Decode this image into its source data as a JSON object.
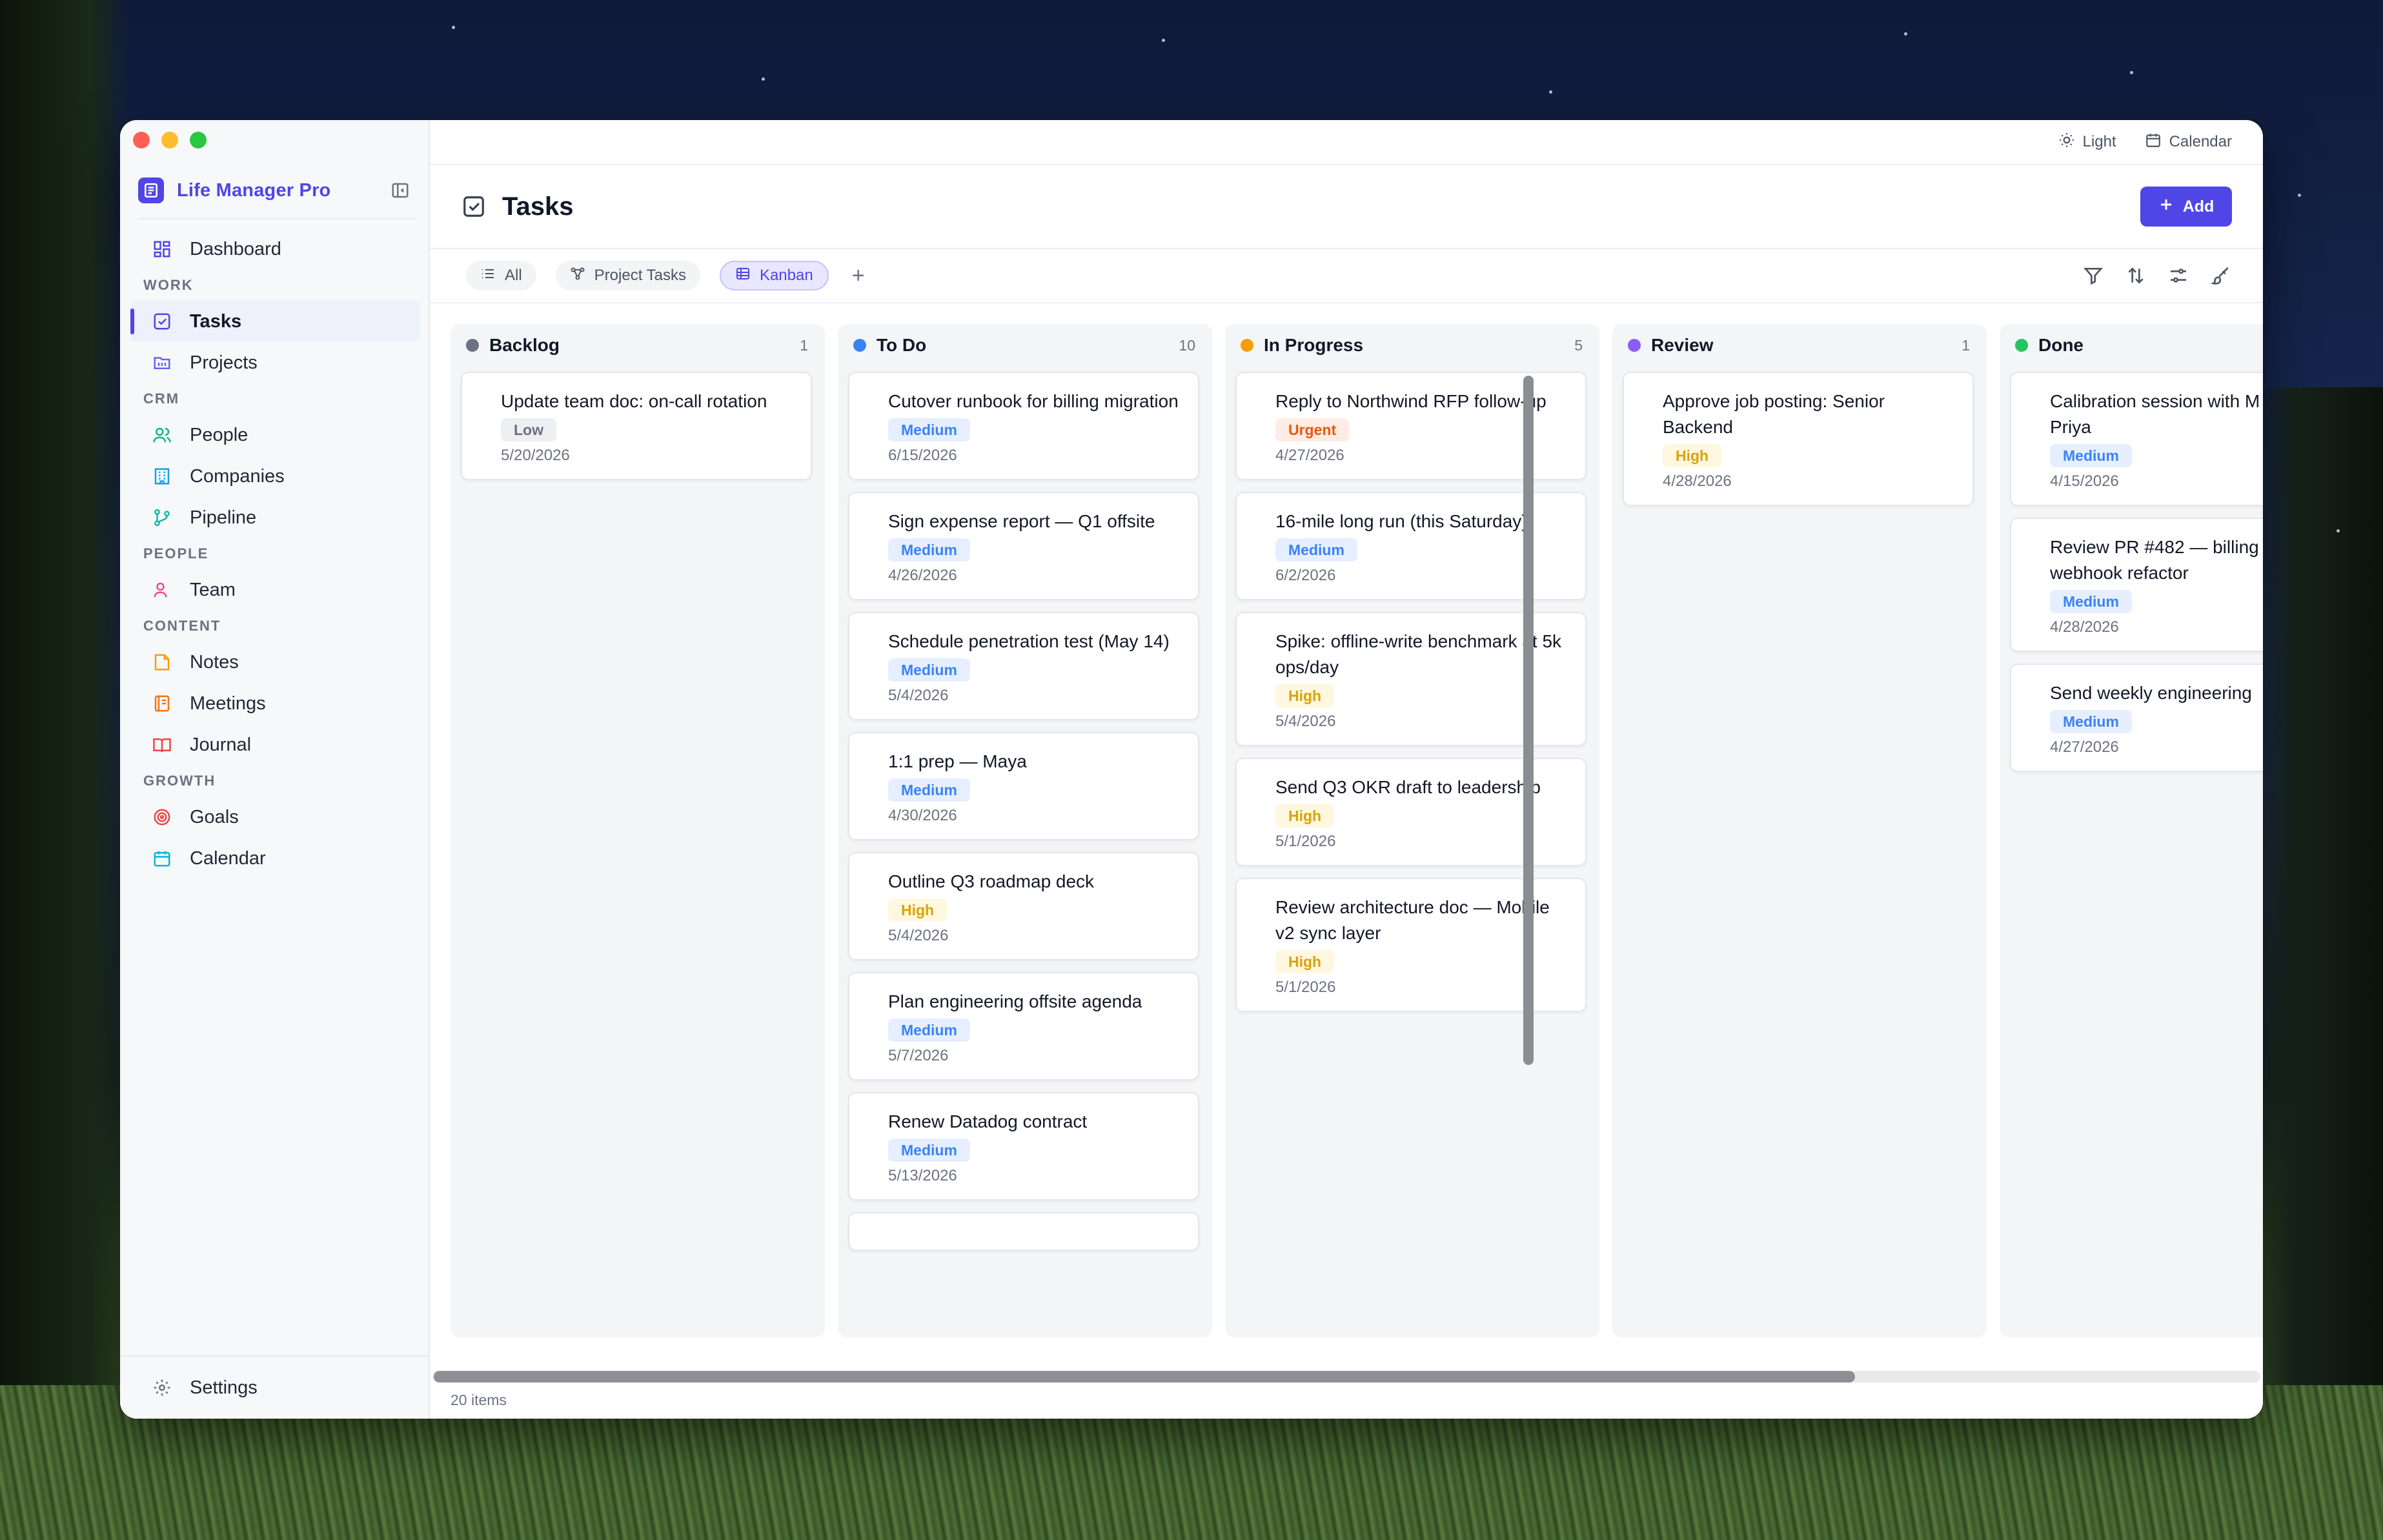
{
  "app": {
    "name": "Life Manager Pro"
  },
  "topbar": {
    "theme_label": "Light",
    "calendar_label": "Calendar"
  },
  "sidebar": {
    "dashboard": "Dashboard",
    "sections": {
      "work": "WORK",
      "crm": "CRM",
      "people": "PEOPLE",
      "content": "CONTENT",
      "growth": "GROWTH"
    },
    "items": {
      "tasks": "Tasks",
      "projects": "Projects",
      "people": "People",
      "companies": "Companies",
      "pipeline": "Pipeline",
      "team": "Team",
      "notes": "Notes",
      "meetings": "Meetings",
      "journal": "Journal",
      "goals": "Goals",
      "calendar": "Calendar"
    },
    "settings": "Settings"
  },
  "page": {
    "title": "Tasks",
    "add_label": "Add"
  },
  "views": {
    "all": "All",
    "project_tasks": "Project Tasks",
    "kanban": "Kanban",
    "add": "+"
  },
  "columns": [
    {
      "title": "Backlog",
      "count": "1",
      "color": "#6b7280",
      "cards": [
        {
          "title": "Update team doc: on-call rotation",
          "priority": "Low",
          "date": "5/20/2026"
        }
      ]
    },
    {
      "title": "To Do",
      "count": "10",
      "color": "#3b82f6",
      "cards": [
        {
          "title": "Cutover runbook for billing migration",
          "priority": "Medium",
          "date": "6/15/2026"
        },
        {
          "title": "Sign expense report — Q1 offsite",
          "priority": "Medium",
          "date": "4/26/2026"
        },
        {
          "title": "Schedule penetration test (May 14)",
          "priority": "Medium",
          "date": "5/4/2026"
        },
        {
          "title": "1:1 prep — Maya",
          "priority": "Medium",
          "date": "4/30/2026"
        },
        {
          "title": "Outline Q3 roadmap deck",
          "priority": "High",
          "date": "5/4/2026"
        },
        {
          "title": "Plan engineering offsite agenda",
          "priority": "Medium",
          "date": "5/7/2026"
        },
        {
          "title": "Renew Datadog contract",
          "priority": "Medium",
          "date": "5/13/2026"
        }
      ]
    },
    {
      "title": "In Progress",
      "count": "5",
      "color": "#f59e0b",
      "cards": [
        {
          "title": "Reply to Northwind RFP follow-up",
          "priority": "Urgent",
          "date": "4/27/2026"
        },
        {
          "title": "16-mile long run (this Saturday)",
          "priority": "Medium",
          "date": "6/2/2026"
        },
        {
          "title": "Spike: offline-write benchmark at 5k ops/day",
          "priority": "High",
          "date": "5/4/2026"
        },
        {
          "title": "Send Q3 OKR draft to leadership",
          "priority": "High",
          "date": "5/1/2026"
        },
        {
          "title": "Review architecture doc — Mobile v2 sync layer",
          "priority": "High",
          "date": "5/1/2026"
        }
      ]
    },
    {
      "title": "Review",
      "count": "1",
      "color": "#8b5cf6",
      "cards": [
        {
          "title": "Approve job posting: Senior Backend",
          "priority": "High",
          "date": "4/28/2026"
        }
      ]
    },
    {
      "title": "Done",
      "count": "",
      "color": "#22c55e",
      "cards": [
        {
          "title": "Calibration session with M Priya",
          "priority": "Medium",
          "date": "4/15/2026"
        },
        {
          "title": "Review PR #482 — billing webhook refactor",
          "priority": "Medium",
          "date": "4/28/2026"
        },
        {
          "title": "Send weekly engineering",
          "priority": "Medium",
          "date": "4/27/2026"
        }
      ]
    }
  ],
  "status": {
    "items": "20 items"
  },
  "icons": {
    "theme": "sun-icon",
    "calendar": "calendar-icon",
    "filter": "filter-icon",
    "sort": "sort-icon",
    "settings_view": "sliders-icon",
    "brush": "paintbrush-icon"
  },
  "colors": {
    "accent": "#4f46e5"
  }
}
